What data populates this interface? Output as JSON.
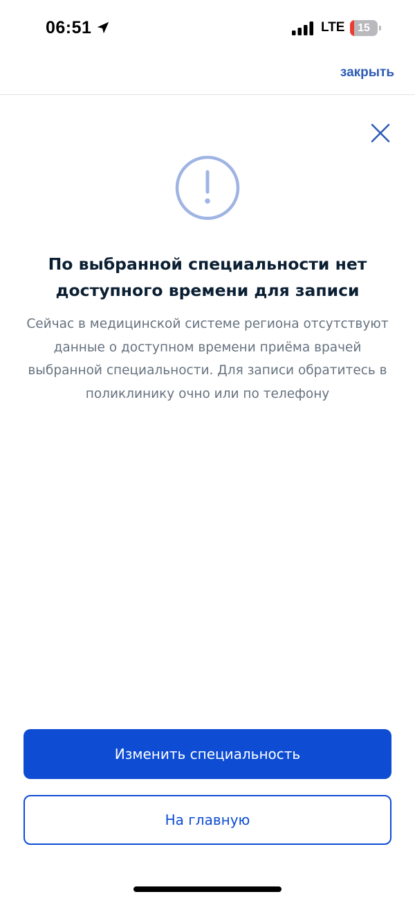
{
  "status_bar": {
    "time": "06:51",
    "network": "LTE",
    "battery_level": "15",
    "battery_fraction": 0.15,
    "icons": [
      "location-arrow-icon",
      "signal-icon",
      "battery-icon"
    ]
  },
  "header": {
    "close_label": "закрыть"
  },
  "dialog": {
    "title": "По выбранной специальности нет доступного времени для записи",
    "description": "Сейчас в медицинской системе региона отсутствуют данные о доступном времени приёма врачей выбранной специальности. Для записи обратитесь в поликлинику очно или по телефону",
    "icon": "warning-icon",
    "dismiss_icon": "close-icon"
  },
  "actions": {
    "primary_label": "Изменить специальность",
    "secondary_label": "На главную"
  },
  "colors": {
    "accent": "#0d4cd3",
    "link": "#2d5bb5",
    "icon_ring": "#9fb4e3",
    "title": "#0b1f33",
    "description": "#66727f",
    "battery_low": "#ec3c32"
  }
}
